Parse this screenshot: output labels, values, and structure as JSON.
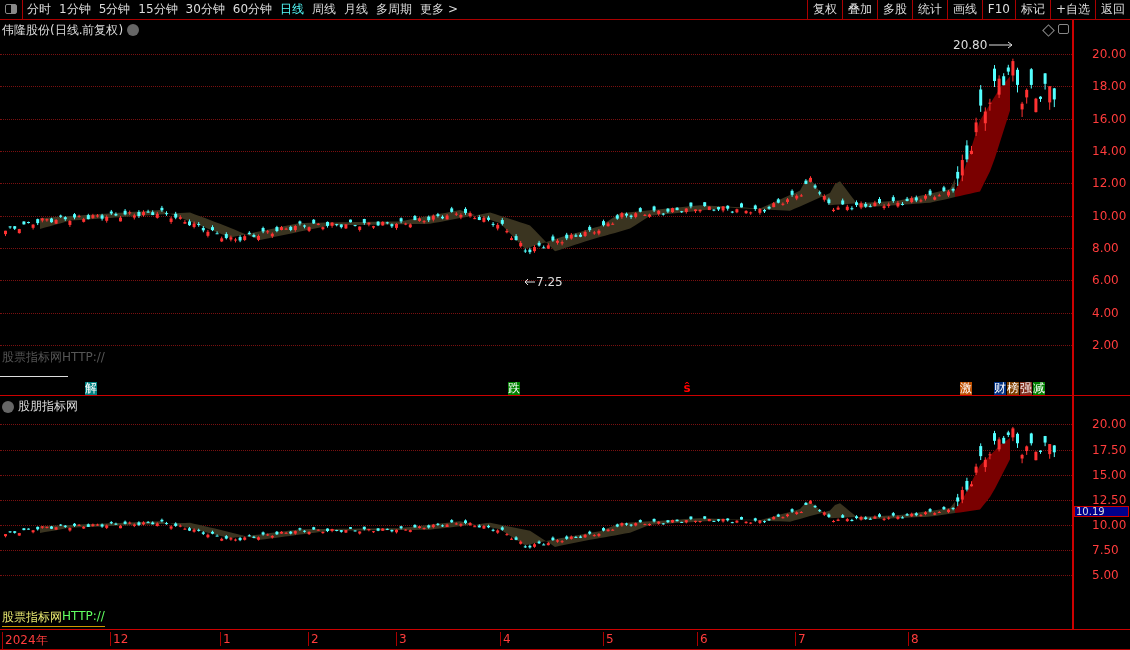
{
  "toolbar": {
    "periods": [
      {
        "label": "分时",
        "selected": false
      },
      {
        "label": "1分钟",
        "selected": false
      },
      {
        "label": "5分钟",
        "selected": false
      },
      {
        "label": "15分钟",
        "selected": false
      },
      {
        "label": "30分钟",
        "selected": false
      },
      {
        "label": "60分钟",
        "selected": false
      },
      {
        "label": "日线",
        "selected": true
      },
      {
        "label": "周线",
        "selected": false
      },
      {
        "label": "月线",
        "selected": false
      },
      {
        "label": "多周期",
        "selected": false
      },
      {
        "label": "更多 >",
        "selected": false
      }
    ],
    "actions": [
      "复权",
      "叠加",
      "多股",
      "统计",
      "画线",
      "F10",
      "标记",
      "+自选",
      "返回"
    ]
  },
  "main_pane": {
    "title": "伟隆股份(日线.前复权)",
    "y_ticks": [
      "20.00",
      "18.00",
      "16.00",
      "14.00",
      "12.00",
      "10.00",
      "8.00",
      "6.00",
      "4.00",
      "2.00"
    ],
    "high_label": "20.80",
    "low_label": "7.25",
    "indicator_label": "股票指标网HTTP://",
    "signals": [
      {
        "label": "解",
        "kind": "tag",
        "color": "#008080"
      },
      {
        "label": "跌",
        "kind": "tag",
        "color": "#008000"
      },
      {
        "label": "ŝ",
        "kind": "glyph",
        "color": "#ff0000"
      },
      {
        "label": "激",
        "kind": "tag",
        "color": "#c05000"
      },
      {
        "label": "财",
        "kind": "tag",
        "color": "#003080"
      },
      {
        "label": "榜",
        "kind": "tag",
        "color": "#804000"
      },
      {
        "label": "强",
        "kind": "tag",
        "color": "#803020"
      },
      {
        "label": "减",
        "kind": "tag",
        "color": "#008000"
      }
    ]
  },
  "sub_pane": {
    "title": "股朋指标网",
    "y_ticks": [
      "20.00",
      "17.50",
      "15.00",
      "12.50",
      "10.00",
      "7.50",
      "5.00"
    ],
    "current_price": "10.19",
    "legend": {
      "name": "股票指标网",
      "url": "HTTP://"
    }
  },
  "time_axis": [
    "2024年",
    "12",
    "1",
    "2",
    "3",
    "4",
    "5",
    "6",
    "7",
    "8"
  ]
}
